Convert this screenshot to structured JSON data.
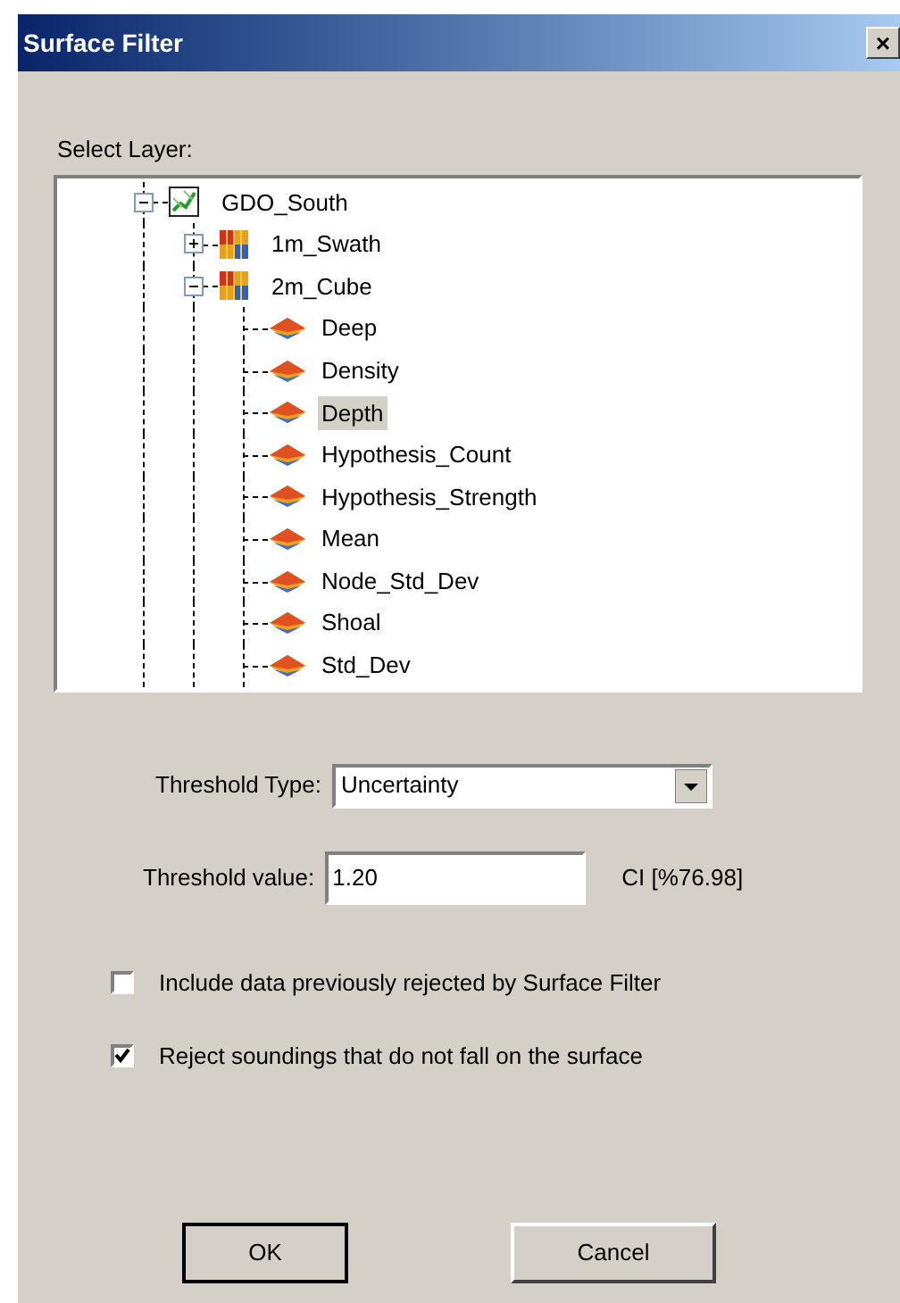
{
  "window": {
    "title": "Surface Filter",
    "close": "×"
  },
  "layer_label": "Select Layer:",
  "tree": [
    {
      "label": "GDO_South",
      "kind": "group",
      "expanded": true,
      "selected": false,
      "children": [
        {
          "label": "1m_Swath",
          "kind": "grid",
          "expanded": false,
          "selected": false
        },
        {
          "label": "2m_Cube",
          "kind": "grid",
          "expanded": true,
          "selected": false,
          "children": [
            {
              "label": "Deep",
              "kind": "layer",
              "selected": false
            },
            {
              "label": "Density",
              "kind": "layer",
              "selected": false
            },
            {
              "label": "Depth",
              "kind": "layer",
              "selected": true
            },
            {
              "label": "Hypothesis_Count",
              "kind": "layer",
              "selected": false
            },
            {
              "label": "Hypothesis_Strength",
              "kind": "layer",
              "selected": false
            },
            {
              "label": "Mean",
              "kind": "layer",
              "selected": false
            },
            {
              "label": "Node_Std_Dev",
              "kind": "layer",
              "selected": false
            },
            {
              "label": "Shoal",
              "kind": "layer",
              "selected": false
            },
            {
              "label": "Std_Dev",
              "kind": "layer",
              "selected": false
            }
          ]
        }
      ]
    }
  ],
  "threshold_type": {
    "label": "Threshold Type:",
    "value": "Uncertainty"
  },
  "threshold_value": {
    "label": "Threshold value:",
    "value": "1.20",
    "note": "CI [%76.98]"
  },
  "options": [
    {
      "label": "Include data previously rejected by Surface Filter",
      "checked": false
    },
    {
      "label": "Reject soundings that do not fall on the surface",
      "checked": true
    }
  ],
  "buttons": [
    {
      "label": "OK",
      "default": true
    },
    {
      "label": "Cancel",
      "default": false
    }
  ]
}
